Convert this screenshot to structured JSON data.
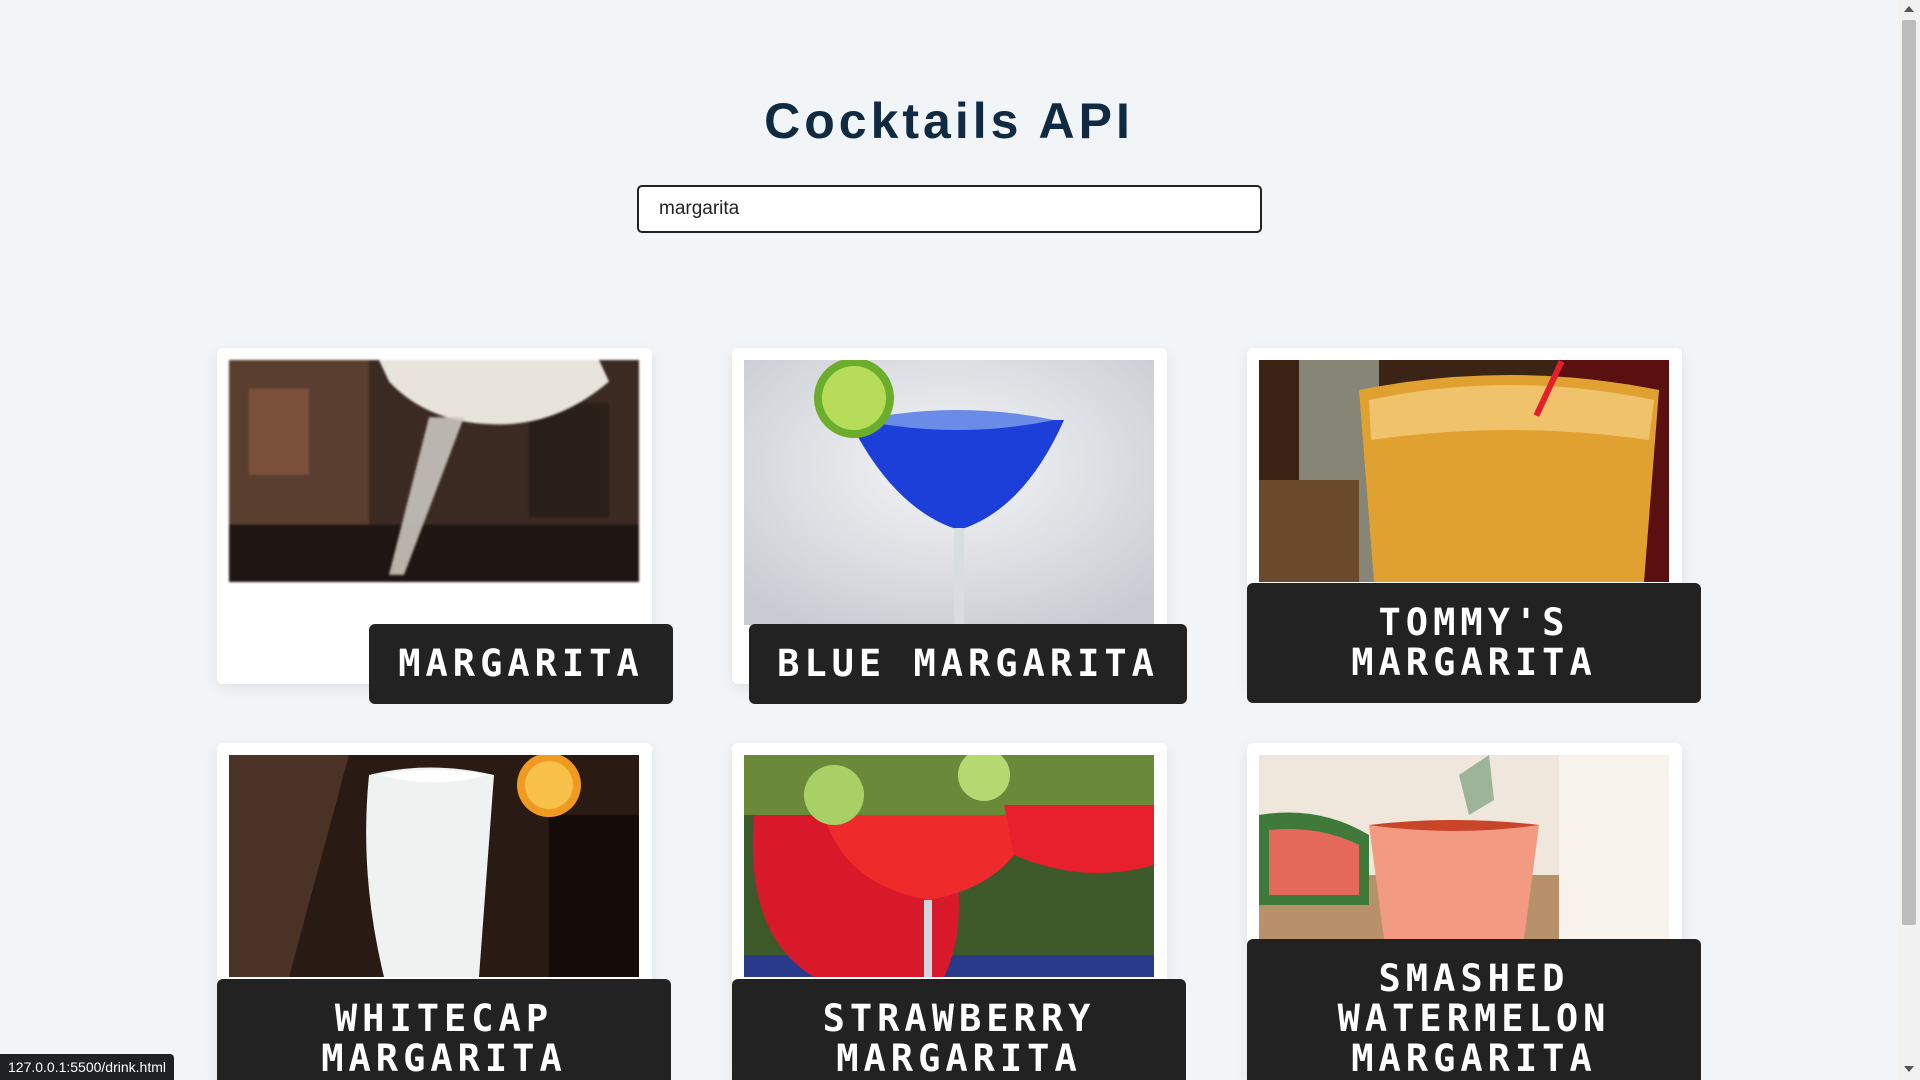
{
  "app": {
    "title": "Cocktails API"
  },
  "search": {
    "value": "margarita",
    "placeholder": ""
  },
  "drinks": [
    {
      "name": "Margarita",
      "image": "drink-photo"
    },
    {
      "name": "Blue Margarita",
      "image": "drink-photo"
    },
    {
      "name": "Tommy's Margarita",
      "image": "drink-photo"
    },
    {
      "name": "Whitecap Margarita",
      "image": "drink-photo"
    },
    {
      "name": "Strawberry Margarita",
      "image": "drink-photo"
    },
    {
      "name": "Smashed Watermelon Margarita",
      "image": "drink-photo"
    }
  ],
  "status": {
    "url": "127.0.0.1:5500/drink.html"
  },
  "colors": {
    "background": "#f1f5f8",
    "title": "#102a42",
    "label_bg": "#222222",
    "label_text": "#ffffff"
  }
}
